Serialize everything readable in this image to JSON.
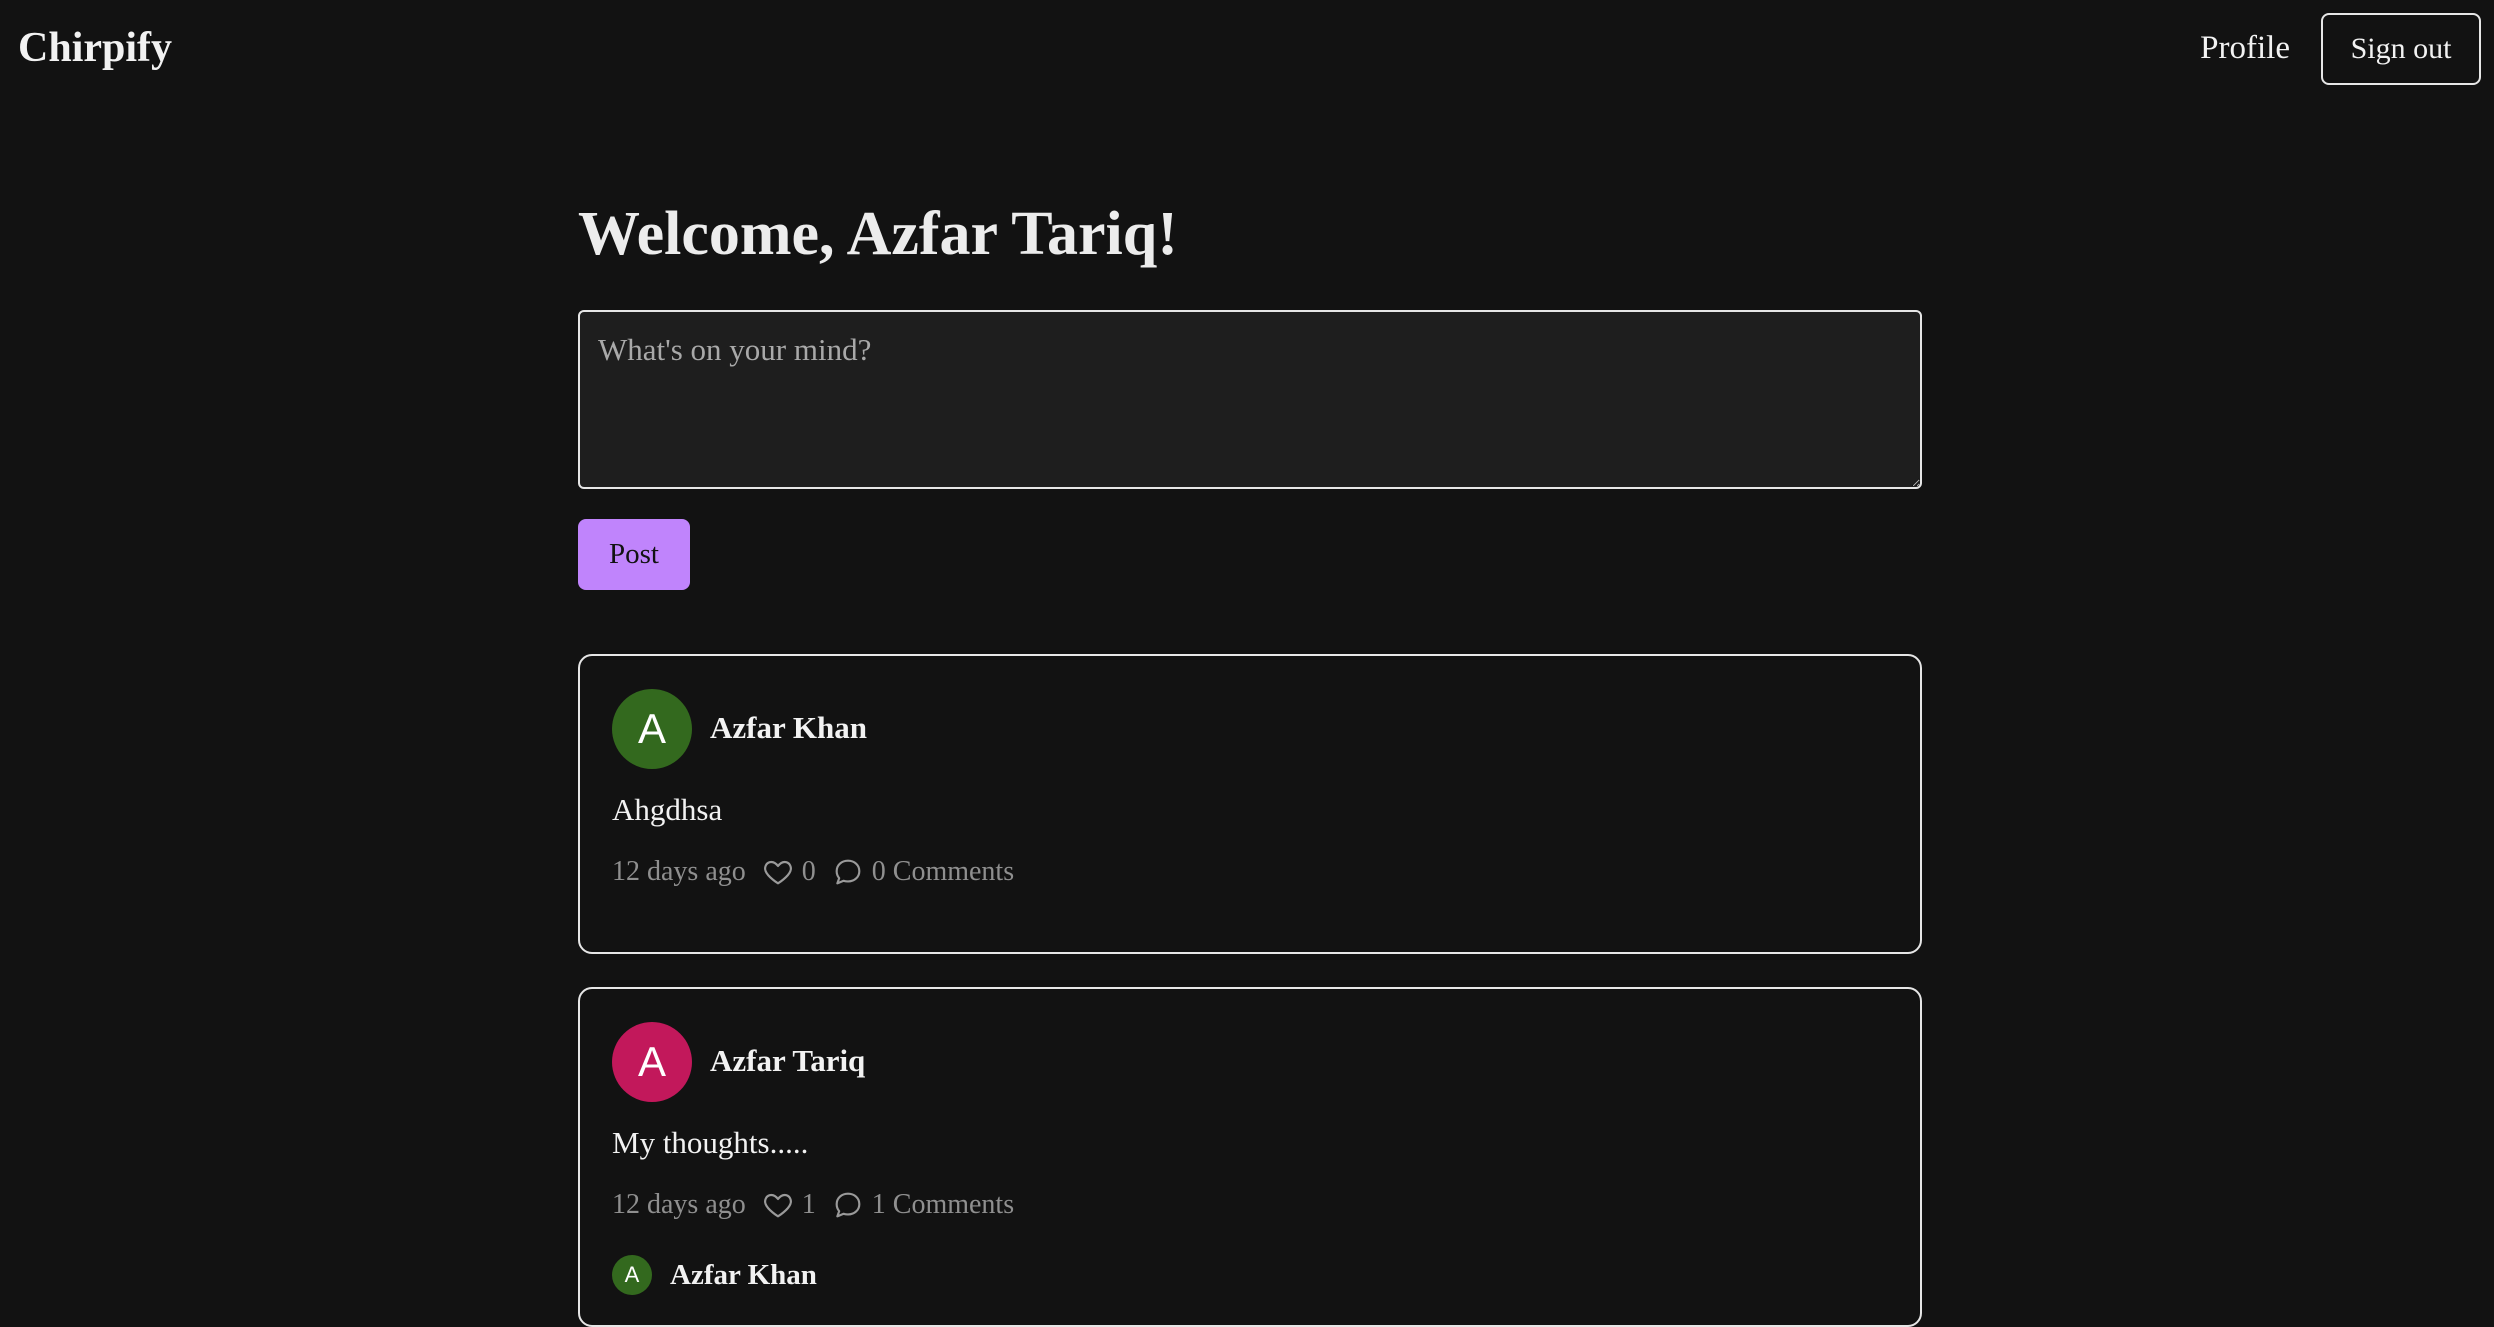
{
  "app": {
    "brand": "Chirpify"
  },
  "nav": {
    "profile": "Profile",
    "signout": "Sign out"
  },
  "welcome": {
    "title": "Welcome, Azfar Tariq!"
  },
  "composer": {
    "placeholder": "What's on your mind?",
    "value": "",
    "post_label": "Post",
    "post_color": "#c084fc"
  },
  "posts": [
    {
      "avatar_letter": "A",
      "avatar_color": "#33691e",
      "author": "Azfar Khan",
      "content": "Ahgdhsa",
      "time": "12 days ago",
      "likes": "0",
      "comments_label": "0 Comments",
      "comments": []
    },
    {
      "avatar_letter": "A",
      "avatar_color": "#c2185b",
      "author": "Azfar Tariq",
      "content": "My thoughts.....",
      "time": "12 days ago",
      "likes": "1",
      "comments_label": "1 Comments",
      "comments": [
        {
          "avatar_letter": "A",
          "avatar_color": "#33691e",
          "author": "Azfar Khan"
        }
      ]
    }
  ]
}
